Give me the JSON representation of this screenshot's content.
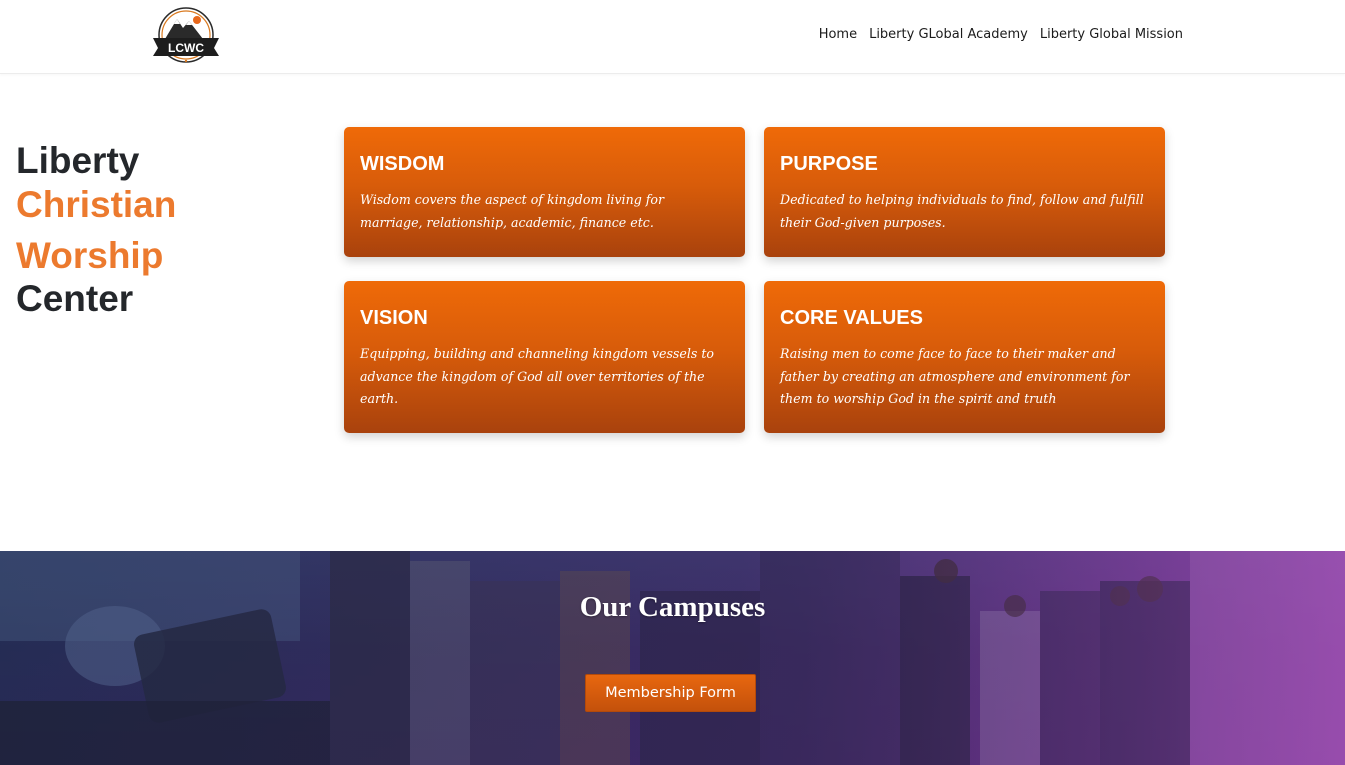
{
  "header": {
    "logo_text": "LCWC",
    "nav": [
      "Home",
      "Liberty GLobal Academy",
      "Liberty Global Mission"
    ]
  },
  "brand": {
    "line1": "Liberty",
    "line2": "Christian",
    "line3": "Worship",
    "line4": "Center"
  },
  "cards": [
    {
      "title": "WISDOM",
      "text": "Wisdom covers the aspect of kingdom living for marriage, relationship, academic, finance etc."
    },
    {
      "title": "PURPOSE",
      "text": "Dedicated to helping individuals to find, follow and fulfill their God-given purposes."
    },
    {
      "title": "VISION",
      "text": "Equipping, building and channeling kingdom vessels to advance the kingdom of God all over territories of the earth."
    },
    {
      "title": "CORE VALUES",
      "text": "Raising men to come face to face to their maker and father by creating an atmosphere and environment for them to worship God in the spirit and truth"
    }
  ],
  "campuses": {
    "title": "Our Campuses",
    "button": "Membership Form"
  },
  "colors": {
    "accent": "#ec7a2e",
    "card_top": "#ef6a08",
    "card_bottom": "#a9420d",
    "hero_overlay": "#963caa"
  }
}
